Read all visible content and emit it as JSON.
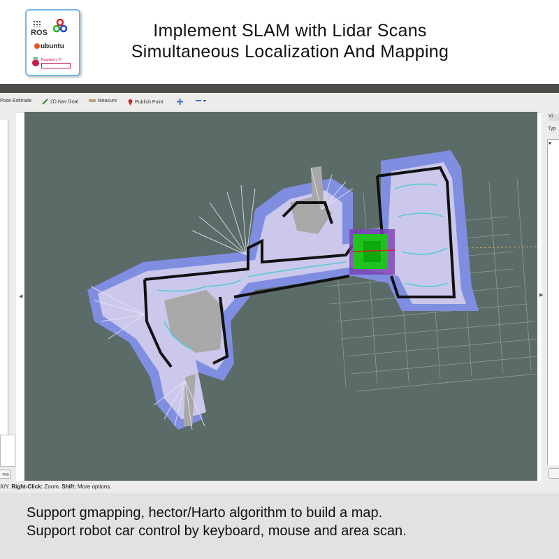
{
  "header": {
    "title_line1": "Implement  SLAM with Lidar Scans",
    "title_line2": "Simultaneous Localization And Mapping",
    "logo": {
      "ros_label": "ROS",
      "ubuntu_label": "ubuntu",
      "rpi_label_line1": "Raspberry Pi",
      "icons": [
        "ros-logo",
        "opencv-logo",
        "ubuntu-logo",
        "raspberry-pi-logo"
      ]
    }
  },
  "toolbar": {
    "items": [
      {
        "label": "Pose Estimate",
        "icon": "pose-estimate-icon"
      },
      {
        "label": "2D Nav Goal",
        "icon": "nav-goal-arrow-icon",
        "color": "#2e8b2e"
      },
      {
        "label": "Measure",
        "icon": "ruler-icon"
      },
      {
        "label": "Publish Point",
        "icon": "map-pin-icon",
        "color": "#cc2222"
      },
      {
        "label": "",
        "icon": "move-camera-icon",
        "color": "#3a6fd8"
      },
      {
        "label": "",
        "icon": "minus-dropdown-icon",
        "color": "#3a6fd8"
      }
    ]
  },
  "left_panel": {
    "button_label": "me"
  },
  "right_panel": {
    "tab_label": "Vi",
    "type_label": "Typ",
    "select_value": "▼"
  },
  "status_bar": {
    "text_bold1": "Right-Click:",
    "text_prefix": "X/Y. ",
    "text_mid": " Zoom. ",
    "text_bold2": "Shift:",
    "text_end": " More options."
  },
  "footer": {
    "line1": "Support gmapping, hector/Harto algorithm to build a map.",
    "line2": "Support robot car control by keyboard, mouse and area scan."
  },
  "colors": {
    "view_background": "#5b6b68",
    "costmap_inflation": "#7f8ee0",
    "free_space": "#c9c6e8",
    "unknown_gray": "#a9a9a9",
    "walls": "#111111",
    "laser_scan": "#22cc22",
    "grid": "#9aa6a3"
  }
}
